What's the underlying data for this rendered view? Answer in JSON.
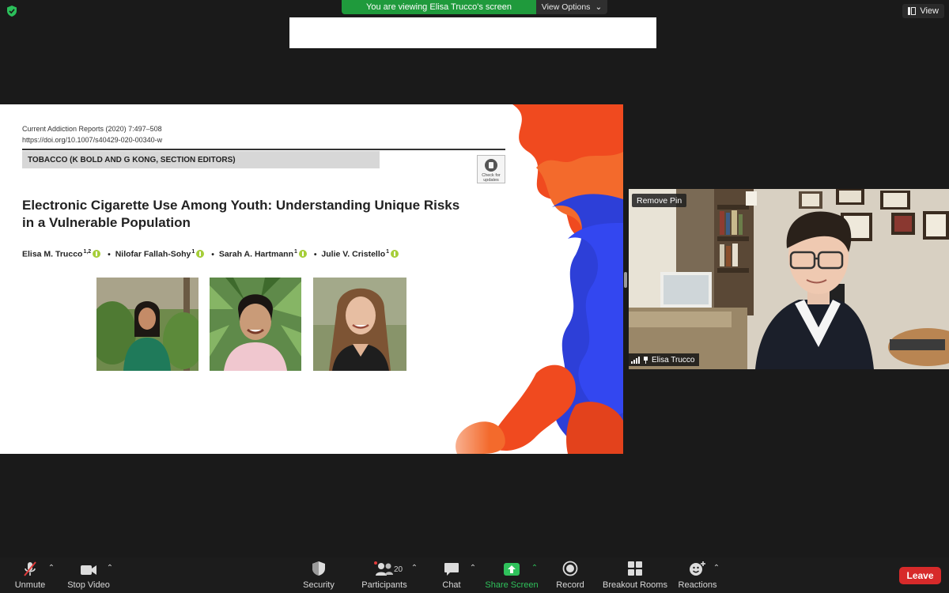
{
  "top_bar": {
    "viewing_label": "You are viewing Elisa Trucco's screen",
    "view_options_label": "View Options",
    "view_label": "View"
  },
  "slide": {
    "journal_line": "Current Addiction Reports (2020) 7:497–508",
    "doi": "https://doi.org/10.1007/s40429-020-00340-w",
    "section": "TOBACCO (K BOLD AND G KONG, SECTION EDITORS)",
    "check_updates": "Check for updates",
    "title": "Electronic Cigarette Use Among Youth: Understanding Unique Risks in a Vulnerable Population",
    "authors": [
      {
        "name": "Elisa M. Trucco",
        "sup": "1,2"
      },
      {
        "name": "Nilofar Fallah-Sohy",
        "sup": "1"
      },
      {
        "name": "Sarah A. Hartmann",
        "sup": "1"
      },
      {
        "name": "Julie V. Cristello",
        "sup": "1"
      }
    ],
    "separator": "•"
  },
  "video": {
    "remove_pin_label": "Remove Pin",
    "participant_name": "Elisa Trucco"
  },
  "toolbar": {
    "unmute": "Unmute",
    "stop_video": "Stop Video",
    "security": "Security",
    "participants": "Participants",
    "participants_count": "20",
    "chat": "Chat",
    "share_screen": "Share Screen",
    "record": "Record",
    "breakout_rooms": "Breakout Rooms",
    "reactions": "Reactions",
    "leave": "Leave"
  },
  "colors": {
    "share_green": "#2fc15b",
    "leave_red": "#d72a2a",
    "banner_green": "#1f9a3c"
  }
}
